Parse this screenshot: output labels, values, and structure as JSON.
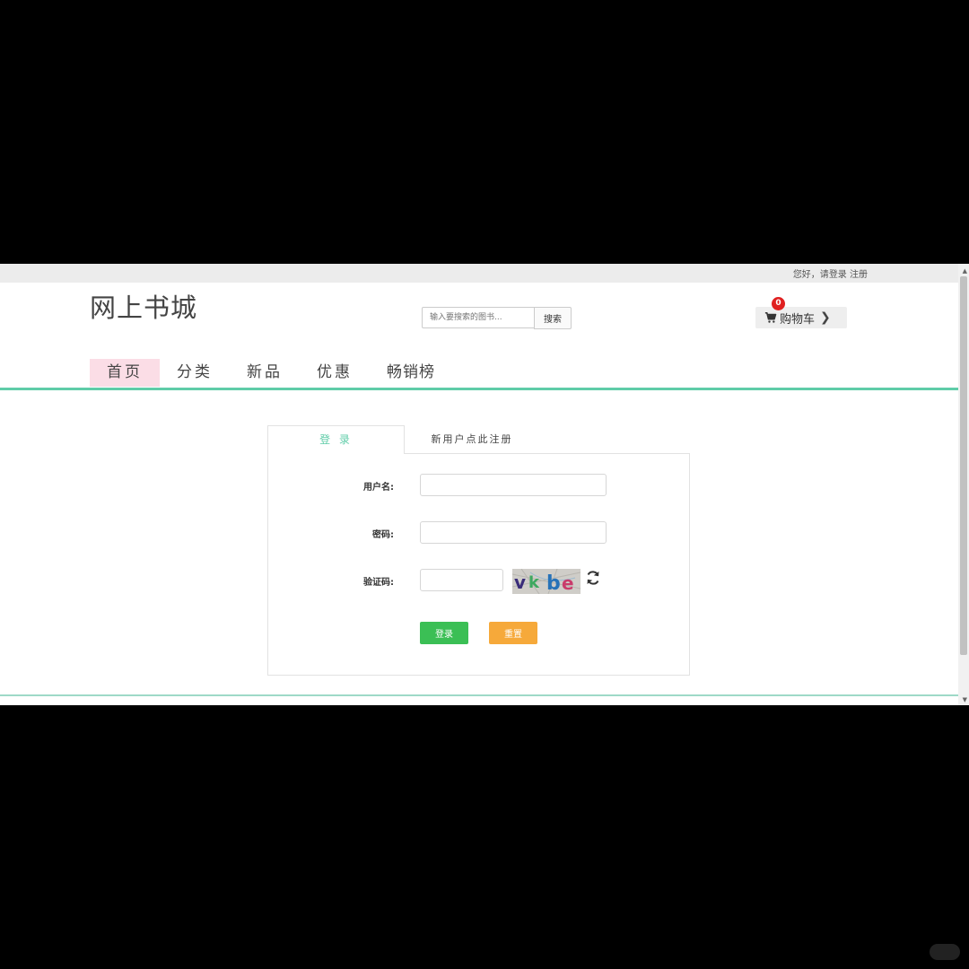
{
  "topbar": {
    "greeting": "您好，请",
    "login": "登录",
    "register": "注册"
  },
  "header": {
    "logo": "网上书城",
    "search_placeholder": "输入要搜索的图书...",
    "search_button": "搜索",
    "cart_label": "购物车",
    "cart_count": "0"
  },
  "nav": {
    "items": [
      "首页",
      "分类",
      "新品",
      "优惠",
      "畅销榜"
    ],
    "active": 0
  },
  "login_panel": {
    "tab_login": "登 录",
    "tab_register": "新用户点此注册",
    "username_label": "用户名:",
    "password_label": "密码:",
    "captcha_label": "验证码:",
    "captcha_text": "vkbe",
    "submit_button": "登录",
    "reset_button": "重置"
  },
  "colors": {
    "accent": "#5fcca8",
    "nav_active_bg": "#fbdde6",
    "login_button": "#3bbf55",
    "reset_button": "#f6a93a",
    "badge": "#e02020"
  }
}
